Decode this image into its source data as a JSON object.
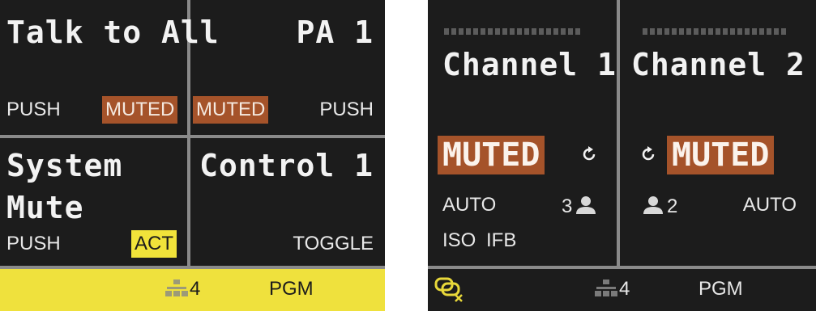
{
  "left_panel": {
    "keys": [
      {
        "title": "Talk to All",
        "mode": "PUSH",
        "badge": "MUTED"
      },
      {
        "title": "PA 1",
        "mode": "PUSH",
        "badge": "MUTED"
      },
      {
        "title_line1": "System",
        "title_line2": "Mute",
        "mode": "PUSH",
        "badge": "ACT"
      },
      {
        "title": "Control 1",
        "mode": "TOGGLE"
      }
    ],
    "footer": {
      "network_count": "4",
      "program": "PGM",
      "bg_color": "#efe13d"
    }
  },
  "right_panel": {
    "channels": [
      {
        "title": "Channel 1",
        "badge": "MUTED",
        "mode": "AUTO",
        "user_count": "3",
        "tags": [
          "ISO",
          "IFB"
        ]
      },
      {
        "title": "Channel 2",
        "badge": "MUTED",
        "mode": "AUTO",
        "user_count": "2"
      }
    ],
    "footer": {
      "network_count": "4",
      "program": "PGM"
    }
  },
  "colors": {
    "muted": "#a5532a",
    "active": "#f1e33a",
    "background": "#1c1c1c",
    "divider": "#8a8a8a"
  },
  "icons": [
    "network-icon",
    "refresh-icon",
    "user-icon",
    "link-disconnected-icon"
  ]
}
